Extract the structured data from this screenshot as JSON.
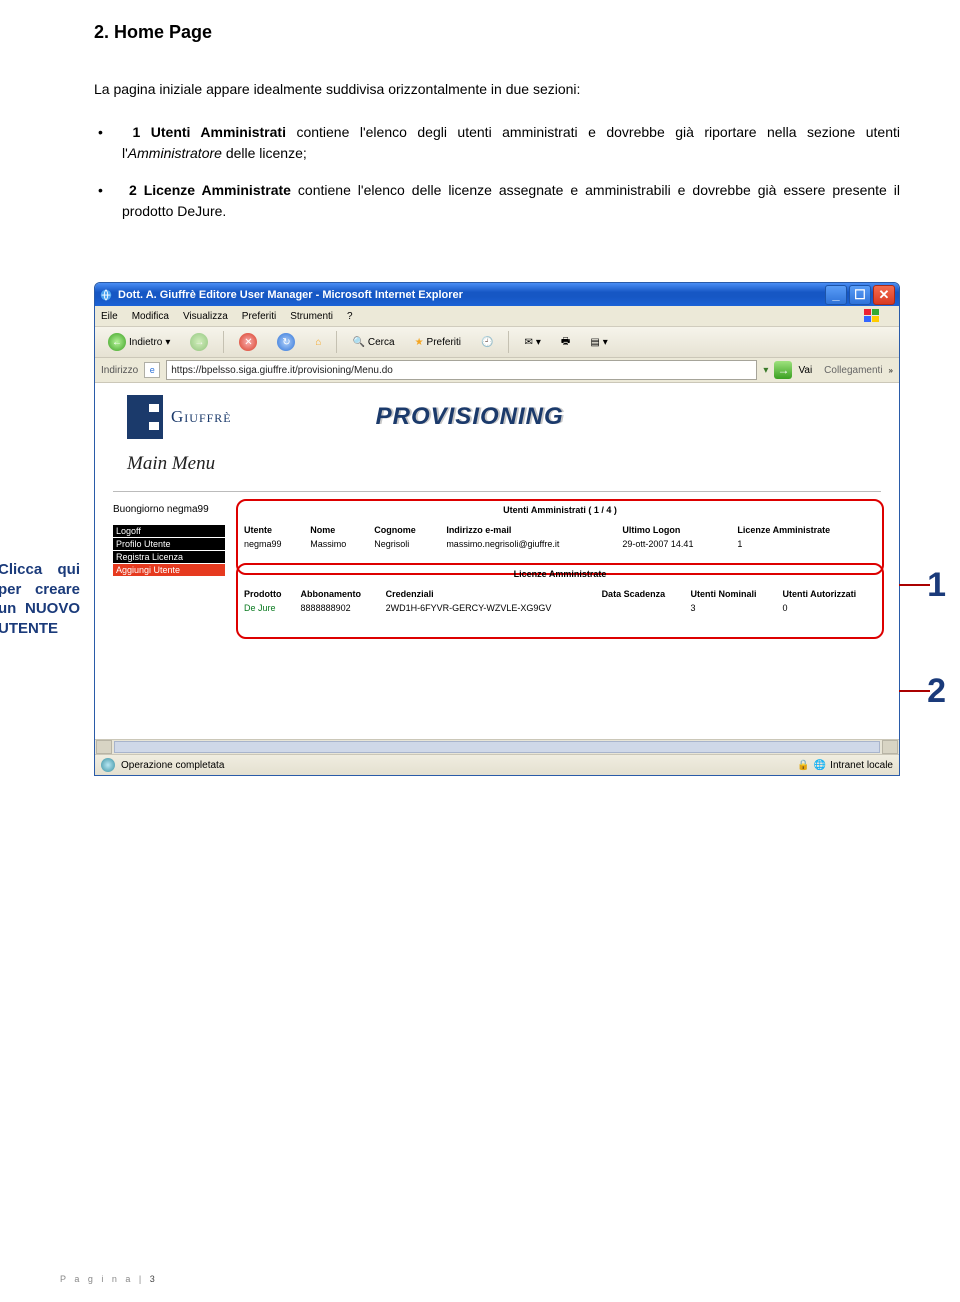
{
  "doc": {
    "section_title": "2. Home Page",
    "intro": "La pagina iniziale appare idealmente suddivisa orizzontalmente in due sezioni:",
    "bullets": [
      {
        "num": "1",
        "strong": "Utenti Amministrati",
        "rest1": " contiene l'elenco degli utenti amministrati e dovrebbe già riportare nella sezione utenti l'",
        "em": "Amministratore",
        "rest2": " delle licenze;"
      },
      {
        "num": "2",
        "strong": "Licenze Amministrate",
        "rest1": " contiene l'elenco delle licenze assegnate e amministrabili e dovrebbe già essere presente il prodotto DeJure.",
        "em": "",
        "rest2": ""
      }
    ],
    "callout": "Clicca qui per creare un NUOVO UTENTE",
    "big1": "1",
    "big2": "2",
    "page_footer_label": "P a g i n a",
    "page_footer_sep": " | ",
    "page_footer_num": "3"
  },
  "win": {
    "title": "Dott. A. Giuffrè Editore User Manager - Microsoft Internet Explorer",
    "menu": [
      "Eile",
      "Modifica",
      "Visualizza",
      "Preferiti",
      "Strumenti",
      "?"
    ],
    "toolbar": {
      "back": "Indietro",
      "search": "Cerca",
      "favorites": "Preferiti"
    },
    "addr_label": "Indirizzo",
    "url": "https://bpelsso.siga.giuffre.it/provisioning/Menu.do",
    "go": "Vai",
    "links": "Collegamenti",
    "status": "Operazione completata",
    "zone": "Intranet locale"
  },
  "app": {
    "brand": "Giuffrè",
    "heading": "PROVISIONING",
    "main_menu": "Main Menu",
    "greeting": "Buongiorno negma99",
    "side_links": [
      "Logoff",
      "Profilo Utente",
      "Registra Licenza",
      "Aggiungi Utente"
    ],
    "box1": {
      "title": "Utenti Amministrati ( 1 / 4 )",
      "headers": [
        "Utente",
        "Nome",
        "Cognome",
        "Indirizzo e-mail",
        "Ultimo Logon",
        "Licenze Amministrate"
      ],
      "rows": [
        {
          "utente": "negma99",
          "nome": "Massimo",
          "cognome": "Negrisoli",
          "email": "massimo.negrisoli@giuffre.it",
          "logon": "29-ott-2007 14.41",
          "lic": "1"
        }
      ]
    },
    "box2": {
      "title": "Licenze Amministrate",
      "headers": [
        "Prodotto",
        "Abbonamento",
        "Credenziali",
        "Data Scadenza",
        "Utenti Nominali",
        "Utenti Autorizzati"
      ],
      "rows": [
        {
          "prodotto": "De Jure",
          "abb": "8888888902",
          "cred": "2WD1H-6FYVR-GERCY-WZVLE-XG9GV",
          "scad": "",
          "nom": "3",
          "aut": "0"
        }
      ]
    }
  }
}
